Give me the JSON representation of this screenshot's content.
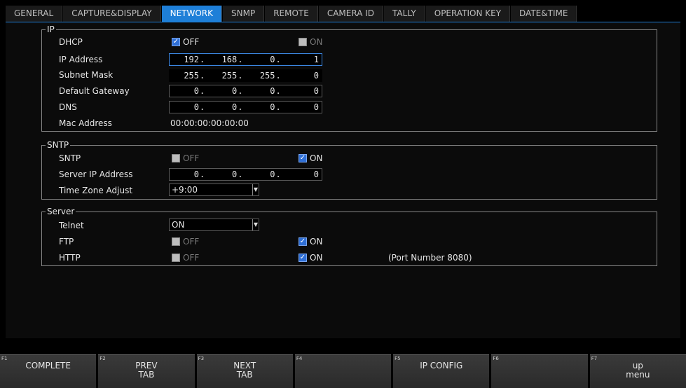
{
  "tabs": [
    "GENERAL",
    "CAPTURE&DISPLAY",
    "NETWORK",
    "SNMP",
    "REMOTE",
    "CAMERA ID",
    "TALLY",
    "OPERATION KEY",
    "DATE&TIME"
  ],
  "ip_section": {
    "legend": "IP",
    "dhcp_label": "DHCP",
    "dhcp_off": "OFF",
    "dhcp_on": "ON",
    "ip_label": "IP Address",
    "ip": [
      "192",
      "168",
      "0",
      "1"
    ],
    "subnet_label": "Subnet Mask",
    "subnet": [
      "255",
      "255",
      "255",
      "0"
    ],
    "gateway_label": "Default Gateway",
    "gateway": [
      "0",
      "0",
      "0",
      "0"
    ],
    "dns_label": "DNS",
    "dns": [
      "0",
      "0",
      "0",
      "0"
    ],
    "mac_label": "Mac Address",
    "mac": "00:00:00:00:00:00"
  },
  "sntp_section": {
    "legend": "SNTP",
    "sntp_label": "SNTP",
    "sntp_off": "OFF",
    "sntp_on": "ON",
    "server_label": "Server IP Address",
    "server": [
      "0",
      "0",
      "0",
      "0"
    ],
    "tz_label": "Time Zone Adjust",
    "tz_value": "+9:00"
  },
  "server_section": {
    "legend": "Server",
    "telnet_label": "Telnet",
    "telnet_value": "ON",
    "ftp_label": "FTP",
    "ftp_off": "OFF",
    "ftp_on": "ON",
    "http_label": "HTTP",
    "http_off": "OFF",
    "http_on": "ON",
    "http_note": "(Port Number 8080)"
  },
  "fkeys": [
    {
      "num": "F1",
      "caption": "COMPLETE"
    },
    {
      "num": "F2",
      "caption": "PREV\nTAB"
    },
    {
      "num": "F3",
      "caption": "NEXT\nTAB"
    },
    {
      "num": "F4",
      "caption": ""
    },
    {
      "num": "F5",
      "caption": "IP CONFIG"
    },
    {
      "num": "F6",
      "caption": ""
    },
    {
      "num": "F7",
      "caption": "up\nmenu"
    }
  ]
}
